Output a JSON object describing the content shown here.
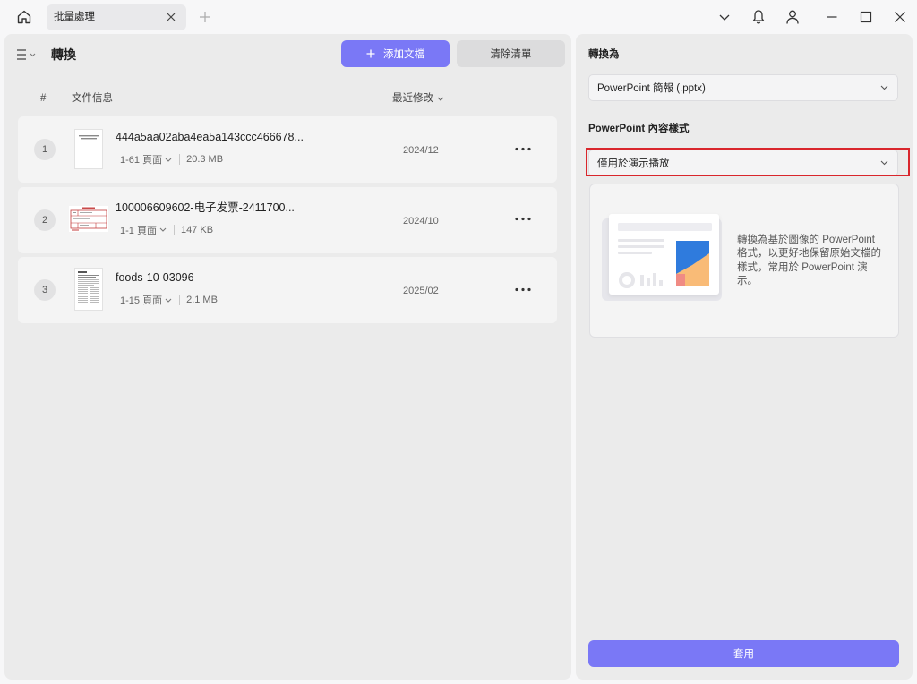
{
  "titlebar": {
    "tab_label": "批量處理",
    "icons": {
      "home": "home-icon",
      "tab_close": "close-icon",
      "new_tab": "plus-icon",
      "dropdown": "chevron-down-icon",
      "notifications": "bell-icon",
      "account": "user-icon",
      "minimize": "minimize-icon",
      "maximize": "maximize-icon",
      "close": "close-icon"
    }
  },
  "converter": {
    "title": "轉換",
    "add_button": "添加文檔",
    "clear_button": "清除清單",
    "columns": {
      "index": "#",
      "info": "文件信息",
      "modified": "最近修改"
    },
    "files": [
      {
        "index": "1",
        "name": "444a5aa02aba4ea5a143ccc466678...",
        "pages": "1-61 頁面",
        "size": "20.3 MB",
        "date": "2024/12"
      },
      {
        "index": "2",
        "name": "100006609602-电子发票-2411700...",
        "pages": "1-1 頁面",
        "size": "147 KB",
        "date": "2024/10"
      },
      {
        "index": "3",
        "name": "foods-10-03096",
        "pages": "1-15 頁面",
        "size": "2.1 MB",
        "date": "2025/02"
      }
    ]
  },
  "settings": {
    "convert_to_label": "轉換為",
    "format_value": "PowerPoint 簡報 (.pptx)",
    "style_label": "PowerPoint 內容樣式",
    "style_value": "僅用於演示播放",
    "description": "轉換為基於圖像的 PowerPoint 格式，以更好地保留原始文檔的樣式，常用於 PowerPoint 演示。",
    "apply_button": "套用"
  },
  "colors": {
    "accent": "#7a78f6",
    "highlight": "#d9262c",
    "panel": "#ebebeb",
    "card": "#f4f4f4"
  }
}
